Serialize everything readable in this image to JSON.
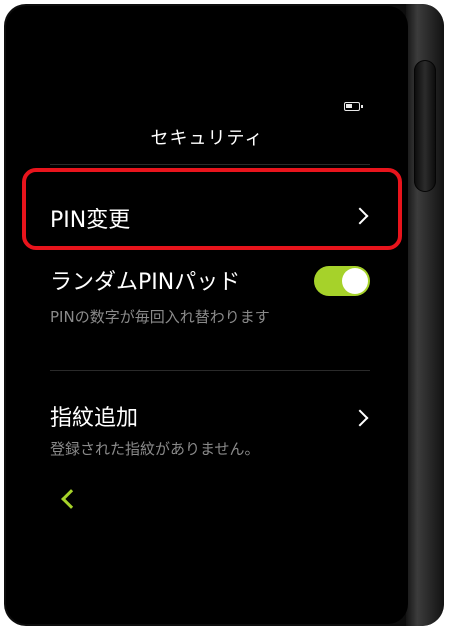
{
  "screen": {
    "title": "セキュリティ",
    "battery_icon": "battery-icon"
  },
  "items": [
    {
      "label": "PIN変更",
      "icon": "chevron-right-icon",
      "highlighted": true
    },
    {
      "label": "ランダムPINパッド",
      "description": "PINの数字が毎回入れ替わります",
      "toggle_on": true
    },
    {
      "label": "指紋追加",
      "description": "登録された指紋がありません。",
      "icon": "chevron-right-icon"
    }
  ],
  "back": {
    "icon": "chevron-left-icon"
  },
  "colors": {
    "accent": "#a6d22a",
    "highlight": "#e8141c",
    "background": "#000000",
    "text": "#ffffff",
    "subtext": "#8a8a8a"
  }
}
